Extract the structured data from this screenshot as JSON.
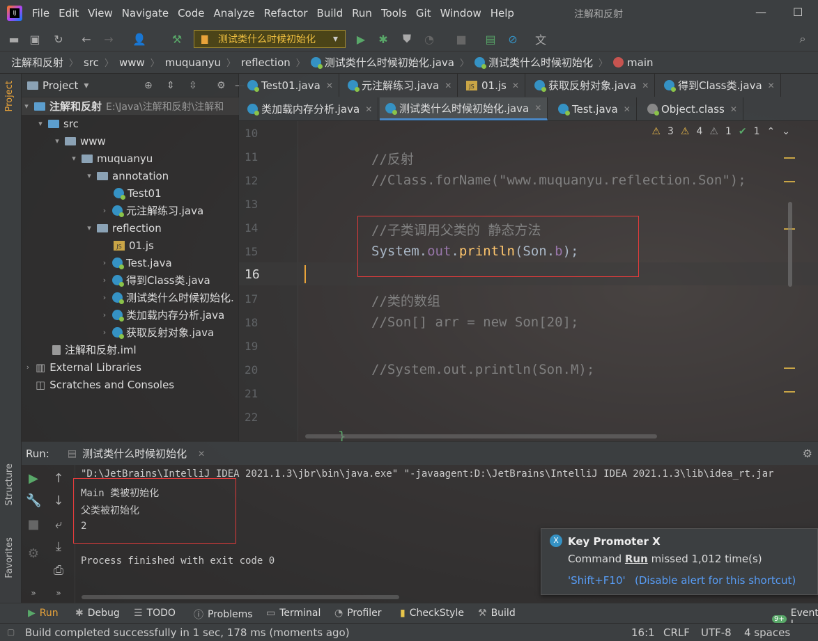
{
  "menu": {
    "items": [
      "File",
      "Edit",
      "View",
      "Navigate",
      "Code",
      "Analyze",
      "Refactor",
      "Build",
      "Run",
      "Tools",
      "Git",
      "Window",
      "Help"
    ],
    "project_title": "注解和反射"
  },
  "toolbar": {
    "run_config": "测试类什么时候初始化"
  },
  "breadcrumb": {
    "items": [
      "注解和反射",
      "src",
      "www",
      "muquanyu",
      "reflection",
      "测试类什么时候初始化.java",
      "测试类什么时候初始化",
      "main"
    ]
  },
  "project_panel": {
    "title": "Project",
    "root_name": "注解和反射",
    "root_path": "E:\\Java\\注解和反射\\注解和",
    "tree": {
      "src": "src",
      "www": "www",
      "muquanyu": "muquanyu",
      "annotation": "annotation",
      "test01": "Test01",
      "meta_annotation": "元注解练习.java",
      "reflection": "reflection",
      "js01": "01.js",
      "test_java": "Test.java",
      "get_class": "得到Class类.java",
      "init_test": "测试类什么时候初始化.",
      "class_load": "类加载内存分析.java",
      "get_reflect": "获取反射对象.java",
      "iml": "注解和反射.iml",
      "external_libs": "External Libraries",
      "scratches": "Scratches and Consoles"
    }
  },
  "editor_tabs": {
    "row1": [
      "Test01.java",
      "元注解练习.java",
      "01.js",
      "获取反射对象.java",
      "得到Class类.java"
    ],
    "row2": [
      "类加载内存分析.java",
      "测试类什么时候初始化.java",
      "Test.java",
      "Object.class"
    ]
  },
  "inspections": {
    "warn_a": "3",
    "warn_b": "4",
    "weak": "1",
    "ok": "1"
  },
  "editor": {
    "line_numbers": [
      "10",
      "11",
      "12",
      "13",
      "14",
      "15",
      "16",
      "17",
      "18",
      "19",
      "20",
      "21",
      "22"
    ],
    "lines": {
      "l11": "//反射",
      "l12": "//Class.forName(\"www.muquanyu.reflection.Son\");",
      "l14": "//子类调用父类的 静态方法",
      "l15_a": "System.",
      "l15_b": "out",
      "l15_c": ".",
      "l15_d": "println",
      "l15_e": "(Son.",
      "l15_f": "b",
      "l15_g": ");",
      "l17": "//类的数组",
      "l18": "//Son[] arr = new Son[20];",
      "l20": "//System.out.println(Son.M);",
      "l23": "}"
    }
  },
  "run_panel": {
    "label": "Run:",
    "tab": "测试类什么时候初始化",
    "console": [
      "\"D:\\JetBrains\\IntelliJ IDEA 2021.1.3\\jbr\\bin\\java.exe\" \"-javaagent:D:\\JetBrains\\IntelliJ IDEA 2021.1.3\\lib\\idea_rt.jar",
      "Main 类被初始化",
      "父类被初始化",
      "2",
      "Process finished with exit code 0"
    ]
  },
  "toast": {
    "title": "Key Promoter X",
    "msg_prefix": "Command ",
    "msg_cmd": "Run",
    "msg_suffix": " missed 1,012 time(s)",
    "shortcut": "'Shift+F10'",
    "disable": "(Disable alert for this shortcut)"
  },
  "bottom_tabs": [
    "Run",
    "Debug",
    "TODO",
    "Problems",
    "Terminal",
    "Profiler",
    "CheckStyle",
    "Build",
    "Event L"
  ],
  "event_badge": "9+",
  "left_tabs": {
    "project": "Project",
    "structure": "Structure",
    "favorites": "Favorites"
  },
  "status": {
    "message": "Build completed successfully in 1 sec, 178 ms (moments ago)",
    "position": "16:1",
    "line_sep": "CRLF",
    "encoding": "UTF-8",
    "indent": "4 spaces"
  }
}
